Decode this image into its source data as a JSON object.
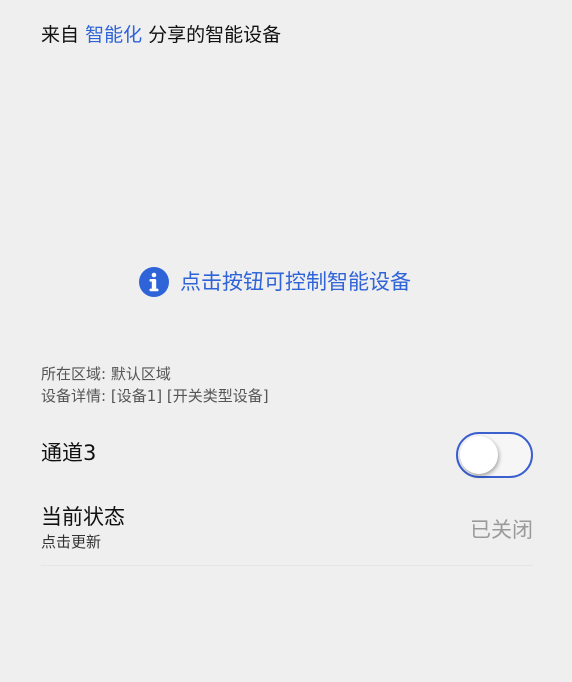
{
  "header": {
    "prefix": "来自",
    "source_name": "智能化",
    "suffix": "分享的智能设备"
  },
  "hint": {
    "icon": "info-icon",
    "text": "点击按钮可控制智能设备"
  },
  "meta": {
    "area_label": "所在区域:",
    "area_value": "默认区域",
    "detail_label": "设备详情:",
    "detail_value": "[设备1] [开关类型设备]"
  },
  "channel": {
    "label": "通道3",
    "toggle_on": false
  },
  "status": {
    "title": "当前状态",
    "subtitle": "点击更新",
    "value": "已关闭"
  },
  "colors": {
    "background": "#efefef",
    "accent": "#2f63d8",
    "toggle_border": "#3a5fcf",
    "muted_text": "#9a9a9a"
  }
}
